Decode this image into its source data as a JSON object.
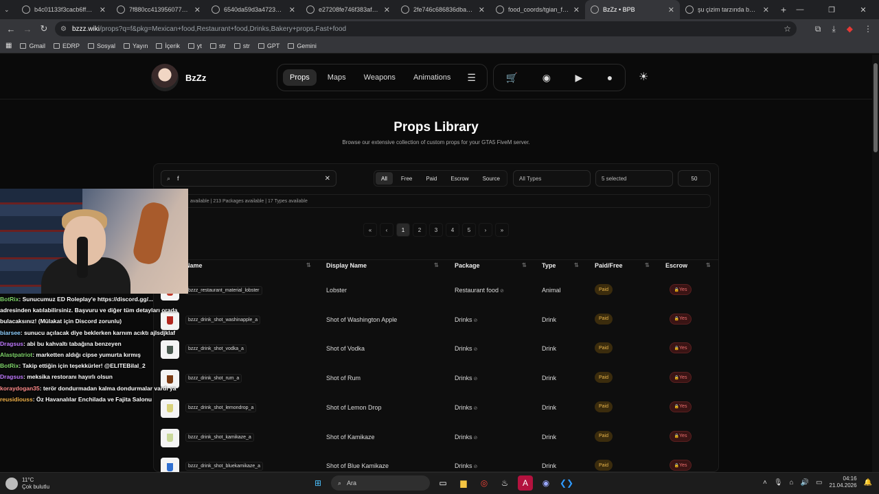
{
  "browser": {
    "tabs": [
      {
        "title": "b4c01133f3cacb6ff9249a…",
        "active": false
      },
      {
        "title": "7f880cc413956077dcdbb…",
        "active": false
      },
      {
        "title": "6540da59d3a472368e7a…",
        "active": false
      },
      {
        "title": "e27208fe746f383afcc47a…",
        "active": false
      },
      {
        "title": "2fe746c686836dba9ec7f…",
        "active": false
      },
      {
        "title": "food_coords/tgian_food_…",
        "active": false
      },
      {
        "title": "BzZz • BPB",
        "active": true
      },
      {
        "title": "şu çizim tarzında bana a…",
        "active": false
      }
    ],
    "url_host": "bzzz.wiki",
    "url_path": "/props?q=f&pkg=Mexican+food,Restaurant+food,Drinks,Bakery+props,Fast+food",
    "bookmarks": [
      "Gmail",
      "EDRP",
      "Sosyal",
      "Yayın",
      "İçerik",
      "yt",
      "str",
      "str",
      "GPT",
      "Gemini"
    ]
  },
  "site": {
    "brand": "BzZz",
    "nav": [
      "Props",
      "Maps",
      "Weapons",
      "Animations"
    ],
    "nav_active": "Props",
    "page_title": "Props Library",
    "page_subtitle": "Browse our extensive collection of custom props for your GTA5 FiveM server.",
    "search_value": "f",
    "filters": [
      "All",
      "Free",
      "Paid",
      "Escrow",
      "Source"
    ],
    "filter_active": "All",
    "type_select": "All Types",
    "package_select": "5 selected",
    "per_page": "50",
    "stats": "available | 213 Packages available | 17 Types available",
    "pages": [
      "«",
      "‹",
      "1",
      "2",
      "3",
      "4",
      "5",
      "›",
      "»"
    ],
    "current_page": "1",
    "columns": [
      "Name",
      "Display Name",
      "Package",
      "Type",
      "Paid/Free",
      "Escrow"
    ],
    "rows": [
      {
        "name": "bzzz_restaurant_material_lobster",
        "display": "Lobster",
        "package": "Restaurant food",
        "type": "Animal",
        "paid": "Paid",
        "escrow": "Yes",
        "color": "#c0392b"
      },
      {
        "name": "bzzz_drink_shot_washinapple_a",
        "display": "Shot of Washington Apple",
        "package": "Drinks",
        "type": "Drink",
        "paid": "Paid",
        "escrow": "Yes",
        "color": "#b3271f"
      },
      {
        "name": "bzzz_drink_shot_vodka_a",
        "display": "Shot of Vodka",
        "package": "Drinks",
        "type": "Drink",
        "paid": "Paid",
        "escrow": "Yes",
        "color": "#4a5a50"
      },
      {
        "name": "bzzz_drink_shot_rum_a",
        "display": "Shot of Rum",
        "package": "Drinks",
        "type": "Drink",
        "paid": "Paid",
        "escrow": "Yes",
        "color": "#7a3a12"
      },
      {
        "name": "bzzz_drink_shot_lemondrop_a",
        "display": "Shot of Lemon Drop",
        "package": "Drinks",
        "type": "Drink",
        "paid": "Paid",
        "escrow": "Yes",
        "color": "#d8d27a"
      },
      {
        "name": "bzzz_drink_shot_kamikaze_a",
        "display": "Shot of Kamikaze",
        "package": "Drinks",
        "type": "Drink",
        "paid": "Paid",
        "escrow": "Yes",
        "color": "#c9d89a"
      },
      {
        "name": "bzzz_drink_shot_bluekamikaze_a",
        "display": "Shot of Blue Kamikaze",
        "package": "Drinks",
        "type": "Drink",
        "paid": "Paid",
        "escrow": "Yes",
        "color": "#2f6fd0"
      }
    ]
  },
  "chat": [
    {
      "user": "BotRix",
      "color": "#7fd46a",
      "text": ": Sunucumuz ED Roleplay'e https://discord.gg/..."
    },
    {
      "user": "",
      "color": "#ffffff",
      "text": "adresinden katılabilirsiniz. Başvuru ve diğer tüm detayları orada"
    },
    {
      "user": "",
      "color": "#ffffff",
      "text": "bulacaksınız! (Mülakat için Discord zorunlu)"
    },
    {
      "user": "biarsee",
      "color": "#8fd0ff",
      "text": ": sunucu açılacak diye beklerken karnım acıktı ajlsdjklaf"
    },
    {
      "user": "Dragsus",
      "color": "#c17bff",
      "text": ": abi bu kahvaltı tabağına benzeyen"
    },
    {
      "user": "Alastpatriot",
      "color": "#7fd46a",
      "text": ": marketten aldığı cipse yumurta kırmış"
    },
    {
      "user": "BotRix",
      "color": "#7fd46a",
      "text": ": Takip ettiğin için teşekkürler! @ELITEBilal_2"
    },
    {
      "user": "Dragsus",
      "color": "#c17bff",
      "text": ": meksika restoranı hayırlı olsun"
    },
    {
      "user": "koraydogan35",
      "color": "#ff8a8a",
      "text": ": terör dondurmadan kalma dondurmalar vardı ya"
    },
    {
      "user": "reusidiouss",
      "color": "#f0b24a",
      "text": ": Öz Havanalılar Enchilada ve Fajita Salonu"
    }
  ],
  "taskbar": {
    "temp": "11°C",
    "weather": "Çok bulutlu",
    "search": "Ara",
    "time": "04:16",
    "date": "21.04.2026"
  }
}
